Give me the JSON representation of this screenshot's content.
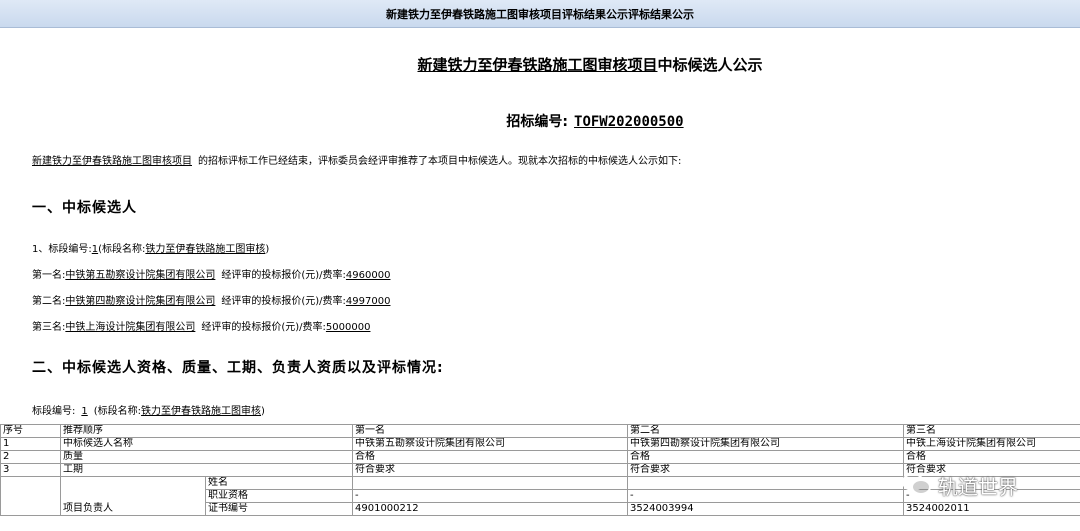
{
  "window": {
    "title": "新建铁力至伊春铁路施工图审核项目评标结果公示评标结果公示"
  },
  "notice": {
    "title_project": "新建铁力至伊春铁路施工图审核项目",
    "title_suffix": "中标候选人公示",
    "code_label": "招标编号:",
    "code_value": "TOFW202000500",
    "intro_project": "新建铁力至伊春铁路施工图审核项目",
    "intro_text": "的招标评标工作已经结束，评标委员会经评审推荐了本项目中标候选人。现就本次招标的中标候选人公示如下:"
  },
  "section1": {
    "heading": "一、中标候选人",
    "lot_prefix": "1、标段编号:",
    "lot_no": "1",
    "lot_name_prefix": "(标段名称:",
    "lot_name": "铁力至伊春铁路施工图审核",
    "lot_name_suffix": ")",
    "price_label": "经评审的投标报价(元)/费率:",
    "candidates": [
      {
        "rank": "第一名:",
        "name": "中铁第五勘察设计院集团有限公司",
        "price": "4960000"
      },
      {
        "rank": "第二名:",
        "name": "中铁第四勘察设计院集团有限公司",
        "price": "4997000"
      },
      {
        "rank": "第三名:",
        "name": "中铁上海设计院集团有限公司",
        "price": "5000000"
      }
    ]
  },
  "section2": {
    "heading": "二、中标候选人资格、质量、工期、负责人资质以及评标情况:",
    "lot_label": "标段编号:",
    "lot_no": "1",
    "lot_name_prefix": "(标段名称:",
    "lot_name": "铁力至伊春铁路施工图审核",
    "lot_name_suffix": ")"
  },
  "table": {
    "header": [
      "序号",
      "推荐顺序",
      "第一名",
      "第二名",
      "第三名"
    ],
    "rows": [
      [
        "1",
        "中标候选人名称",
        "中铁第五勘察设计院集团有限公司",
        "中铁第四勘察设计院集团有限公司",
        "中铁上海设计院集团有限公司"
      ],
      [
        "2",
        "质量",
        "合格",
        "合格",
        "合格"
      ],
      [
        "3",
        "工期",
        "符合要求",
        "符合要求",
        "符合要求"
      ]
    ],
    "manager": {
      "label": "项目负责人",
      "sub": [
        {
          "label": "姓名",
          "values": [
            "",
            "",
            ""
          ]
        },
        {
          "label": "职业资格",
          "values": [
            "-",
            "-",
            "-"
          ]
        },
        {
          "label": "证书编号",
          "values": [
            "4901000212",
            "3524003994",
            "3524002011"
          ]
        }
      ]
    }
  },
  "watermark": {
    "text": "轨道世界",
    "icon": "wechat-icon"
  }
}
